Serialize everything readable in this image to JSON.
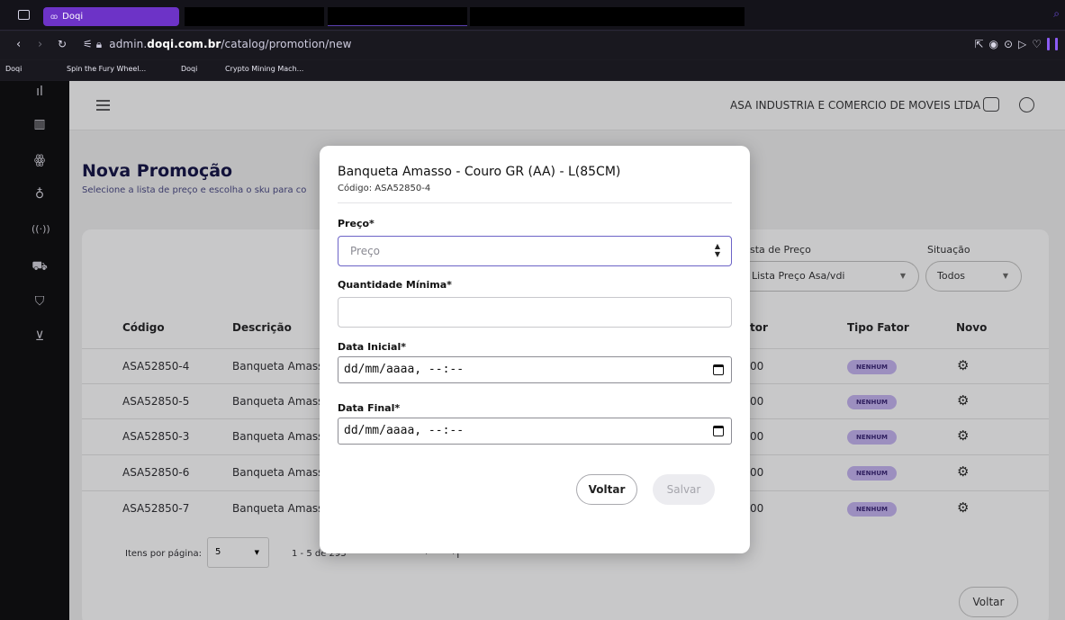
{
  "browser": {
    "tab_label": "Doqi",
    "tab_favicon": "Doqi-favicon-icon",
    "url_prefix": "admin.",
    "url_domain": "doqi.com.br",
    "url_path": "/catalog/promotion/new",
    "bookmarks": [
      "Doqi",
      "Spin the Fury Wheel...",
      "Doqi",
      "Crypto Mining Mach..."
    ],
    "accent": "#6d33c7"
  },
  "header": {
    "company": "ASA INDUSTRIA E COMERCIO DE MOVEIS LTDA"
  },
  "page": {
    "title": "Nova Promoção",
    "subtitle": "Selecione a lista de preço e escolha o sku para co"
  },
  "filters": {
    "price_list_label": "sta de Preço",
    "price_list_value": "Lista Preço Asa/vdi",
    "status_label": "Situação",
    "status_value": "Todos"
  },
  "table": {
    "headers": [
      "Código",
      "Descrição",
      "tor",
      "Tipo Fator",
      "Novo"
    ],
    "rows": [
      {
        "code": "ASA52850-4",
        "desc": "Banqueta Amasso",
        "fator": "00",
        "tipo": "NENHUM"
      },
      {
        "code": "ASA52850-5",
        "desc": "Banqueta Amasso",
        "fator": "00",
        "tipo": "NENHUM"
      },
      {
        "code": "ASA52850-3",
        "desc": "Banqueta Amasso",
        "fator": "00",
        "tipo": "NENHUM"
      },
      {
        "code": "ASA52850-6",
        "desc": "Banqueta Amasso",
        "fator": "00",
        "tipo": "NENHUM"
      },
      {
        "code": "ASA52850-7",
        "desc": "Banqueta Amasso",
        "fator": "00",
        "tipo": "NENHUM"
      }
    ]
  },
  "pagination": {
    "items_label": "Itens por página:",
    "items_value": "5",
    "range": "1 - 5 de 293"
  },
  "footer": {
    "back": "Voltar"
  },
  "modal": {
    "title": "Banqueta Amasso - Couro GR (AA) - L(85CM)",
    "code": "Código: ASA52850-4",
    "price_label": "Preço*",
    "price_placeholder": "Preço",
    "qty_label": "Quantidade Mínima*",
    "start_label": "Data Inicial*",
    "start_value": "dd/mm/aaaa, --:--",
    "end_label": "Data Final*",
    "end_value": "dd/mm/aaaa, --:--",
    "back_button": "Voltar",
    "save_button": "Salvar"
  }
}
